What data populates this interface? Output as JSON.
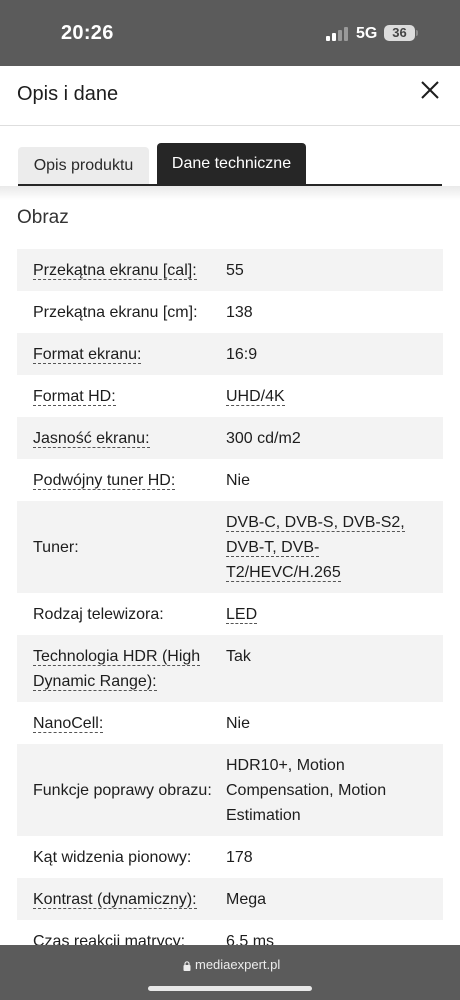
{
  "status_bar": {
    "time": "20:26",
    "network": "5G",
    "battery": "36"
  },
  "header": {
    "title": "Opis i dane"
  },
  "tabs": [
    {
      "label": "Opis produktu",
      "active": false
    },
    {
      "label": "Dane techniczne",
      "active": true
    }
  ],
  "section": {
    "title": "Obraz"
  },
  "specs": [
    {
      "label": "Przekątna ekranu [cal]:",
      "value": "55"
    },
    {
      "label": "Przekątna ekranu [cm]:",
      "value": "138"
    },
    {
      "label": "Format ekranu:",
      "value": "16:9"
    },
    {
      "label": "Format HD:",
      "value": "UHD/4K"
    },
    {
      "label": "Jasność ekranu:",
      "value": "300 cd/m2"
    },
    {
      "label": "Podwójny tuner HD:",
      "value": "Nie"
    },
    {
      "label": "Tuner:",
      "value": "DVB-C, DVB-S, DVB-S2, DVB-T, DVB-T2/HEVC/H.265"
    },
    {
      "label": "Rodzaj telewizora:",
      "value": "LED"
    },
    {
      "label": "Technologia HDR (High Dynamic Range):",
      "value": "Tak"
    },
    {
      "label": "NanoCell:",
      "value": "Nie"
    },
    {
      "label": "Funkcje poprawy obrazu:",
      "value": "HDR10+, Motion Compensation, Motion Estimation"
    },
    {
      "label": "Kąt widzenia pionowy:",
      "value": "178"
    },
    {
      "label": "Kontrast (dynamiczny):",
      "value": "Mega"
    },
    {
      "label": "Czas reakcji matrycy:",
      "value": "6.5 ms"
    }
  ],
  "browser": {
    "url": "mediaexpert.pl"
  }
}
